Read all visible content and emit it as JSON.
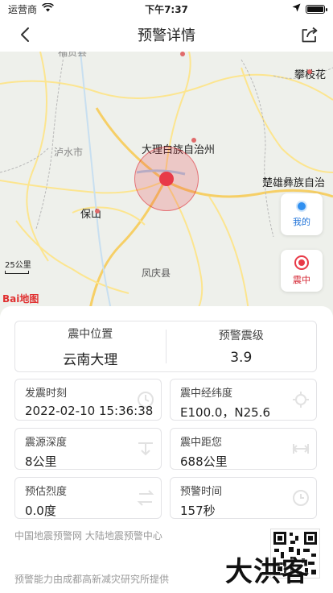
{
  "status_bar": {
    "carrier": "运营商",
    "time": "下午7:37",
    "battery_level": 1.0
  },
  "nav": {
    "title": "预警详情"
  },
  "map": {
    "labels": {
      "top_left": "福贡县",
      "panzhihua": "攀枝花",
      "lushui": "泸水市",
      "dali": "大理白族自治州",
      "chuxiong": "楚雄彝族自治",
      "baoshan": "保山",
      "fengqing": "凤庆县"
    },
    "scale": "25公里",
    "logo": "Bai地图",
    "buttons": {
      "me": "我的",
      "epicenter": "震中"
    }
  },
  "summary": {
    "location_label": "震中位置",
    "location_value": "云南大理",
    "magnitude_label": "预警震级",
    "magnitude_value": "3.9"
  },
  "details": [
    {
      "label": "发震时刻",
      "value": "2022-02-10 15:36:38",
      "icon": "clock-icon"
    },
    {
      "label": "震中经纬度",
      "value": "E100.0，N25.6",
      "icon": "crosshair-icon"
    },
    {
      "label": "震源深度",
      "value": "8公里",
      "icon": "depth-icon"
    },
    {
      "label": "震中距您",
      "value": "688公里",
      "icon": "distance-icon"
    },
    {
      "label": "预估烈度",
      "value": "0.0度",
      "icon": "intensity-icon"
    },
    {
      "label": "预警时间",
      "value": "157秒",
      "icon": "timer-icon"
    }
  ],
  "footer": {
    "source": "中国地震预警网 大陆地震预警中心",
    "powered": "预警能力由成都高新减灾研究所提供",
    "brand": "大洪客"
  },
  "colors": {
    "accent_red": "#e83a48",
    "accent_blue": "#2f8ff0"
  }
}
